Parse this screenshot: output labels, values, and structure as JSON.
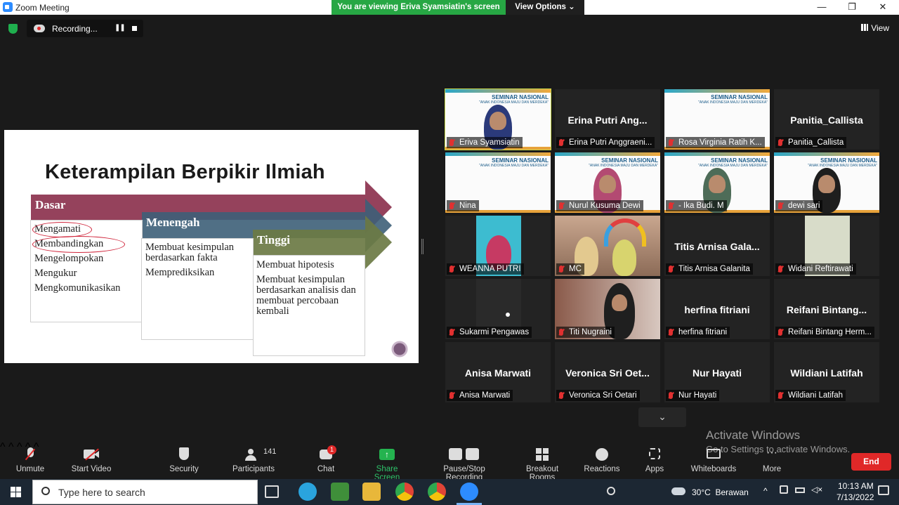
{
  "window": {
    "title": "Zoom Meeting",
    "minimize": "—",
    "restore": "❐",
    "close": "✕"
  },
  "share_banner": {
    "message": "You are viewing Eriva Syamsiatin's screen",
    "view_options": "View Options ⌄"
  },
  "recording": {
    "label": "Recording...",
    "pause": "❚❚"
  },
  "view_button": "View",
  "slide": {
    "title": "Keterampilan Berpikir Ilmiah",
    "levels": [
      {
        "name": "Dasar",
        "color": "#8a2e4a",
        "items": [
          "Mengamati",
          "Membandingkan",
          "Mengelompokan",
          "Mengukur",
          "Mengkomunikasikan"
        ]
      },
      {
        "name": "Menengah",
        "color": "#3d5f78",
        "items": [
          "Membuat kesimpulan berdasarkan fakta",
          "Memprediksikan"
        ]
      },
      {
        "name": "Tinggi",
        "color": "#6b7a44",
        "items": [
          "Membuat hipotesis",
          "Membuat kesimpulan berdasarkan analisis dan membuat percobaan kembali"
        ]
      }
    ]
  },
  "participants": [
    {
      "label": "Eriva Syamsiatin",
      "big": "",
      "kind": "seminar-person",
      "active": true,
      "pinned": true
    },
    {
      "label": "Erina Putri Anggraeni...",
      "big": "Erina Putri Ang...",
      "kind": "name"
    },
    {
      "label": "Rosa Virginia Ratih K...",
      "big": "",
      "kind": "seminar"
    },
    {
      "label": "Panitia_Callista",
      "big": "Panitia_Callista",
      "kind": "name"
    },
    {
      "label": "Nina",
      "big": "",
      "kind": "seminar"
    },
    {
      "label": "Nurul Kusuma Dewi",
      "big": "",
      "kind": "seminar-person"
    },
    {
      "label": "- Ika Budi. M",
      "big": "",
      "kind": "seminar-person"
    },
    {
      "label": "dewi sari",
      "big": "",
      "kind": "seminar-person"
    },
    {
      "label": "WEANNA PUTRI",
      "big": "",
      "kind": "video-pink"
    },
    {
      "label": "MC",
      "big": "",
      "kind": "video-room"
    },
    {
      "label": "Titis Arnisa Galanita",
      "big": "Titis Arnisa Gala...",
      "kind": "name"
    },
    {
      "label": "Widani Reftirawati",
      "big": "",
      "kind": "video-pale"
    },
    {
      "label": "Sukarmi Pengawas",
      "big": "",
      "kind": "video-dark"
    },
    {
      "label": "Titi Nugraini",
      "big": "",
      "kind": "video-room2"
    },
    {
      "label": "herfina fitriani",
      "big": "herfina fitriani",
      "kind": "name"
    },
    {
      "label": "Reifani Bintang Herm...",
      "big": "Reifani Bintang...",
      "kind": "name"
    },
    {
      "label": "Anisa Marwati",
      "big": "Anisa Marwati",
      "kind": "name"
    },
    {
      "label": "Veronica Sri Oetari",
      "big": "Veronica Sri Oet...",
      "kind": "name"
    },
    {
      "label": "Nur Hayati",
      "big": "Nur Hayati",
      "kind": "name"
    },
    {
      "label": "Wildiani Latifah",
      "big": "Wildiani Latifah",
      "kind": "name"
    }
  ],
  "seminar": {
    "title": "SEMINAR NASIONAL",
    "subtitle": "\"ANAK INDONESIA MAJU DAN MERDEKA\""
  },
  "activate": {
    "line1": "Activate Windows",
    "line2": "Go to Settings to activate Windows."
  },
  "toolbar": {
    "unmute": "Unmute",
    "start_video": "Start Video",
    "security": "Security",
    "participants": "Participants",
    "participant_count": "141",
    "chat": "Chat",
    "chat_badge": "1",
    "share_screen": "Share Screen",
    "pause_stop": "Pause/Stop Recording",
    "breakout": "Breakout Rooms",
    "reactions": "Reactions",
    "apps": "Apps",
    "whiteboards": "Whiteboards",
    "more": "More",
    "end": "End"
  },
  "taskbar": {
    "search_placeholder": "Type here to search",
    "weather": "30°C  Berawan",
    "time": "10:13 AM",
    "date": "7/13/2022"
  }
}
